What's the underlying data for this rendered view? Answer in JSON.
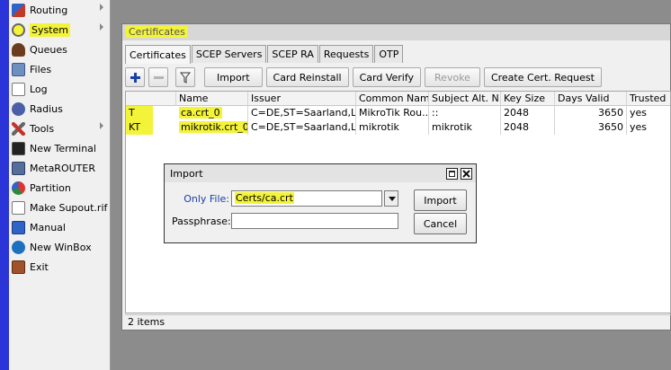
{
  "menu": {
    "items": [
      {
        "label": "Routing"
      },
      {
        "label": "System"
      },
      {
        "label": "Queues"
      },
      {
        "label": "Files"
      },
      {
        "label": "Log"
      },
      {
        "label": "Radius"
      },
      {
        "label": "Tools"
      },
      {
        "label": "New Terminal"
      },
      {
        "label": "MetaROUTER"
      },
      {
        "label": "Partition"
      },
      {
        "label": "Make Supout.rif"
      },
      {
        "label": "Manual"
      },
      {
        "label": "New WinBox"
      },
      {
        "label": "Exit"
      }
    ]
  },
  "window": {
    "title": "Certificates",
    "tabs": [
      "Certificates",
      "SCEP Servers",
      "SCEP RA",
      "Requests",
      "OTP"
    ],
    "toolbar": {
      "import": "Import",
      "card_reinstall": "Card Reinstall",
      "card_verify": "Card Verify",
      "revoke": "Revoke",
      "create_request": "Create Cert. Request"
    },
    "columns": [
      "Name",
      "Issuer",
      "Common Name",
      "Subject Alt. N...",
      "Key Size",
      "Days Valid",
      "Trusted"
    ],
    "rows": [
      {
        "flags": "T",
        "name": "ca.crt_0",
        "issuer": "C=DE,ST=Saarland,L...",
        "common_name": "MikroTik Rou...",
        "subject_alt": "::",
        "key_size": "2048",
        "days_valid": "3650",
        "trusted": "yes"
      },
      {
        "flags": "KT",
        "name": "mikrotik.crt_0",
        "issuer": "C=DE,ST=Saarland,L...",
        "common_name": "mikrotik",
        "subject_alt": "mikrotik",
        "key_size": "2048",
        "days_valid": "3650",
        "trusted": "yes"
      }
    ],
    "status": "2 items"
  },
  "dialog": {
    "title": "Import",
    "only_file_label": "Only File:",
    "only_file_value": "Certs/ca.crt",
    "passphrase_label": "Passphrase:",
    "passphrase_value": "",
    "import_button": "Import",
    "cancel_button": "Cancel"
  },
  "colors": {
    "highlight": "#f3f33a",
    "blue_bar": "#2b34d6",
    "background": "#8c8c8c"
  }
}
